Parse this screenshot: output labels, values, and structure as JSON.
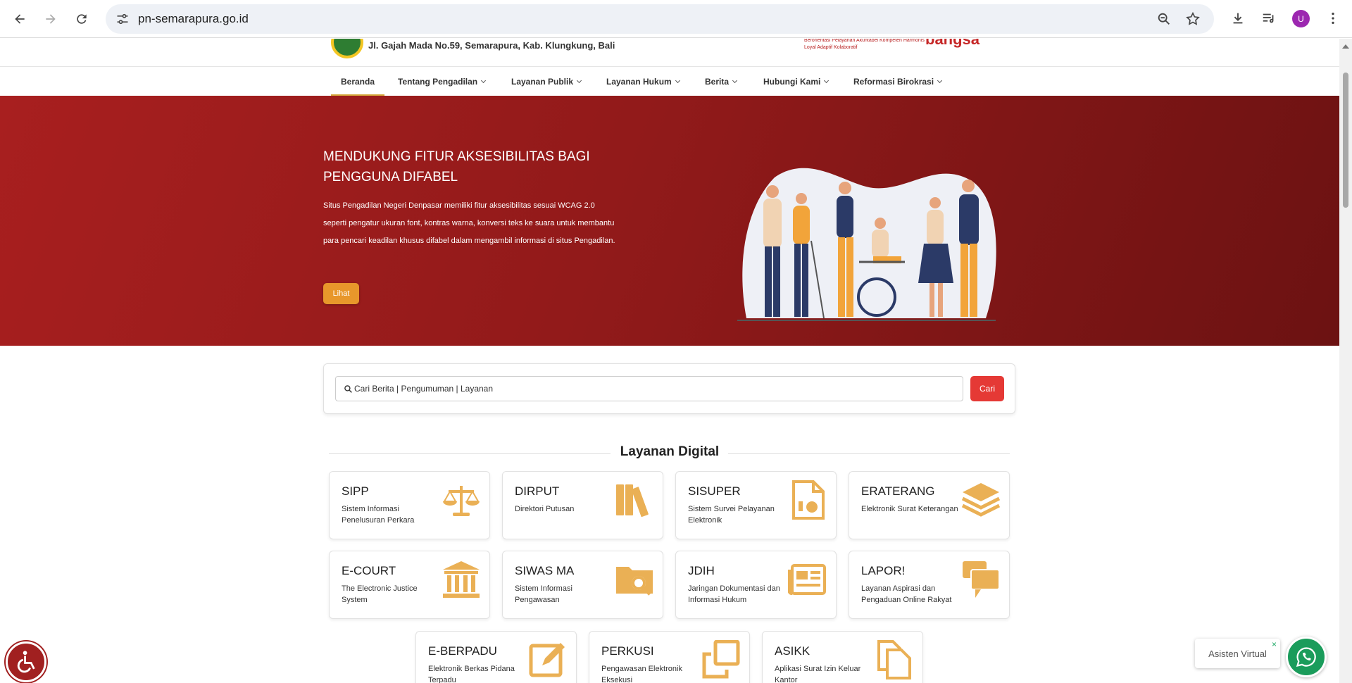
{
  "browser": {
    "url": "pn-semarapura.go.id",
    "profile_initial": "U",
    "icons": [
      "back-icon",
      "forward-icon",
      "reload-icon",
      "site-settings-icon",
      "zoom-icon",
      "bookmark-star-icon",
      "download-icon",
      "media-control-icon",
      "more-vert-icon"
    ]
  },
  "header": {
    "address": "Jl. Gajah Mada No.59, Semarapura, Kab. Klungkung, Bali",
    "tagline": "Berorientasi Pelayanan Akuntabel Kompeten Harmonis Loyal Adaptif Kolaboratif",
    "brand": "bangsa"
  },
  "nav": {
    "items": [
      {
        "label": "Beranda",
        "dropdown": false,
        "active": true
      },
      {
        "label": "Tentang Pengadilan",
        "dropdown": true
      },
      {
        "label": "Layanan Publik",
        "dropdown": true
      },
      {
        "label": "Layanan Hukum",
        "dropdown": true
      },
      {
        "label": "Berita",
        "dropdown": true
      },
      {
        "label": "Hubungi Kami",
        "dropdown": true
      },
      {
        "label": "Reformasi Birokrasi",
        "dropdown": true
      }
    ]
  },
  "hero": {
    "title": "MENDUKUNG FITUR AKSESIBILITAS BAGI PENGGUNA DIFABEL",
    "description": "Situs Pengadilan Negeri Denpasar memiliki fitur aksesibilitas sesuai WCAG 2.0 seperti pengatur ukuran font, kontras warna, konversi teks ke suara untuk membantu para pencari keadilan khusus difabel dalam mengambil informasi di situs Pengadilan.",
    "button_label": "Lihat"
  },
  "search": {
    "placeholder": "Cari Berita | Pengumuman | Layanan",
    "button_label": "Cari"
  },
  "layanan": {
    "title": "Layanan Digital",
    "cards": [
      {
        "title": "SIPP",
        "subtitle": "Sistem Informasi Penelusuran Perkara",
        "icon": "scale-icon"
      },
      {
        "title": "DIRPUT",
        "subtitle": "Direktori Putusan",
        "icon": "books-icon"
      },
      {
        "title": "SISUPER",
        "subtitle": "Sistem Survei Pelayanan Elektronik",
        "icon": "report-icon"
      },
      {
        "title": "ERATERANG",
        "subtitle": "Elektronik Surat Keterangan",
        "icon": "layers-icon"
      },
      {
        "title": "E-COURT",
        "subtitle": "The Electronic Justice System",
        "icon": "courthouse-icon"
      },
      {
        "title": "SIWAS MA",
        "subtitle": "Sistem Informasi Pengawasan",
        "icon": "folder-search-icon"
      },
      {
        "title": "JDIH",
        "subtitle": "Jaringan Dokumentasi dan Informasi Hukum",
        "icon": "newspaper-icon"
      },
      {
        "title": "LAPOR!",
        "subtitle": "Layanan Aspirasi dan Pengaduan Online Rakyat",
        "icon": "chat-icon"
      },
      {
        "title": "E-BERPADU",
        "subtitle": "Elektronik Berkas Pidana Terpadu",
        "icon": "edit-icon"
      },
      {
        "title": "PERKUSI",
        "subtitle": "Pengawasan Elektronik Eksekusi",
        "icon": "clone-icon"
      },
      {
        "title": "ASIKK",
        "subtitle": "Aplikasi Surat Izin Keluar Kantor",
        "icon": "copy-icon"
      }
    ]
  },
  "widgets": {
    "assistant_label": "Asisten Virtual",
    "close_label": "×"
  },
  "colors": {
    "hero_red": "#a81f1f",
    "accent_orange": "#e8a93f",
    "search_red": "#e53935",
    "whatsapp_green": "#1a9c5b"
  }
}
